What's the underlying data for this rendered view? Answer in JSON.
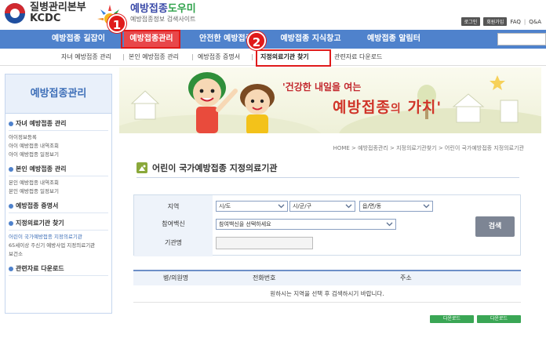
{
  "header": {
    "org_line1": "질병관리본부",
    "org_line2": "KCDC",
    "site_name_part1": "예방접종",
    "site_name_part2": "도우미",
    "site_sub": "예방접종정보 검색사이트",
    "util": {
      "login": "로그인",
      "join": "회원가입",
      "faq": "FAQ",
      "qna": "Q&A"
    }
  },
  "nav": {
    "items": [
      "예방접종 길잡이",
      "예방접종관리",
      "안전한 예방접종",
      "예방접종 지식창고",
      "예방접종 알림터"
    ]
  },
  "subnav": {
    "items": [
      "자녀 예방접종 관리",
      "본인 예방접종 관리",
      "예방접종 증명서",
      "지정의료기관 찾기",
      "관련자료 다운로드"
    ],
    "sep": "|"
  },
  "markers": {
    "one": "1",
    "two": "2"
  },
  "sidebar": {
    "title": "예방접종관리",
    "sections": [
      {
        "label": "자녀 예방접종 관리",
        "links": [
          "아이정보등록",
          "아이 예방접종 내역조회",
          "아이 예방접종 일정보기"
        ]
      },
      {
        "label": "본인 예방접종 관리",
        "links": [
          "본인 예방접종 내역조회",
          "본인 예방접종 일정보기"
        ]
      },
      {
        "label": "예방접종 증명서",
        "links": []
      },
      {
        "label": "지정의료기관 찾기",
        "links": [
          "어린이 국가예방접종 지정의료기관",
          "65세이상 주신기 예방사업 지정의료기관",
          "보건소"
        ]
      },
      {
        "label": "관련자료 다운로드",
        "links": []
      }
    ]
  },
  "banner": {
    "slogan1": "'건강한 내일을 여는",
    "slogan2a": "예방접종",
    "slogan2b": "의",
    "slogan2c": "가치'"
  },
  "breadcrumb": "HOME > 예방접종관리 > 지정의료기관찾기 > 어린이 국가예방접종 지정의료기관",
  "page_title": "어린이 국가예방접종 지정의료기관",
  "form": {
    "region_label": "지역",
    "sido": "시/도",
    "sigungu": "시/군/구",
    "eupmyeondong": "읍/면/동",
    "vaccine_label": "참여백신",
    "vaccine_value": "참여백신을 선택하세요",
    "org_label": "기관명",
    "org_value": "",
    "search_button": "검색"
  },
  "table": {
    "headers": [
      "병/의원명",
      "전화번호",
      "주소"
    ],
    "empty_message": "원하시는 지역을 선택 후 검색하시기 바랍니다."
  },
  "downloads": [
    "다운로드",
    "다운로드"
  ],
  "colors": {
    "nav": "#4f82cc",
    "marker": "#e01a1a",
    "search_button": "#7d8594",
    "download": "#3aa655"
  }
}
